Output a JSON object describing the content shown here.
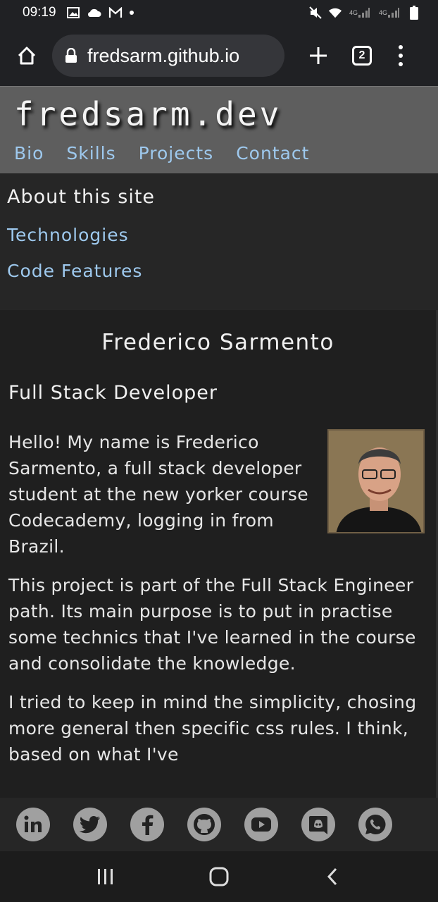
{
  "status": {
    "time": "09:19",
    "left_icons": [
      "image-icon",
      "cloud-icon",
      "gmail-icon",
      "dot-icon"
    ],
    "right_icons": [
      "mute-icon",
      "wifi-icon",
      "signal-4g-icon",
      "signal-4g-icon",
      "battery-icon"
    ],
    "network_label_1": "4G",
    "network_label_2": "4G"
  },
  "browser": {
    "url": "fredsarm.github.io",
    "tab_count": "2"
  },
  "site": {
    "title": "fredsarm.dev",
    "nav": [
      "Bio",
      "Skills",
      "Projects",
      "Contact"
    ]
  },
  "sub_nav": {
    "title": "About this site",
    "links": [
      "Technologies",
      "Code Features"
    ]
  },
  "main": {
    "name": "Frederico Sarmento",
    "role": "Full Stack Developer",
    "paragraphs": [
      "Hello! My name is Frederico Sarmento, a full stack developer student at the new yorker course Codecademy, logging in from Brazil.",
      "This project is part of the Full Stack Engineer path. Its main purpose is to put in practise some technics that I've learned in the course and consolidate the knowledge.",
      "I tried to keep in mind the simplicity, chosing more general then specific css rules. I think, based on what I've"
    ]
  },
  "social": [
    "linkedin-icon",
    "twitter-icon",
    "facebook-icon",
    "github-icon",
    "youtube-icon",
    "discord-icon",
    "whatsapp-icon"
  ],
  "colors": {
    "link": "#9ec9ee",
    "header_bg": "#5e5e5e",
    "page_bg": "#1f1f1f"
  }
}
